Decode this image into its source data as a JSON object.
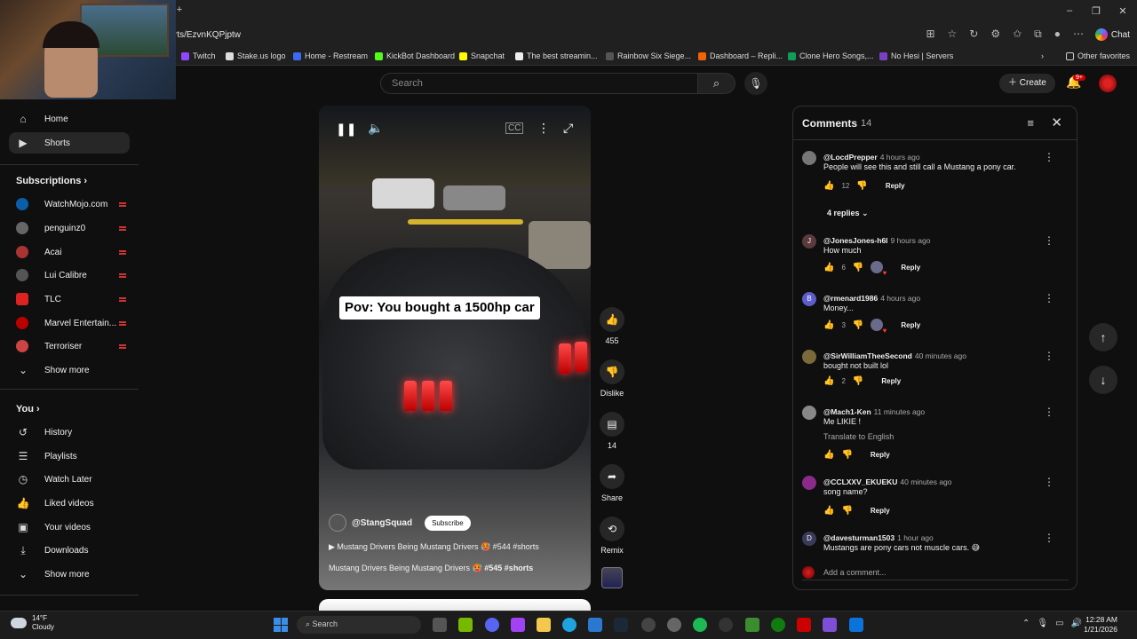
{
  "browser": {
    "url": "rts/EzvnKQPjptw",
    "chat_label": "Chat",
    "bookmarks": [
      "Twitch",
      "Stake.us logo",
      "Home - Restream",
      "KickBot Dashboard",
      "Snapchat",
      "The best streamin...",
      "Rainbow Six Siege...",
      "Dashboard – Repli...",
      "Clone Hero Songs,...",
      "No Hesi | Servers"
    ],
    "other_favorites": "Other favorites"
  },
  "header": {
    "search_placeholder": "Search",
    "create_label": "Create",
    "notification_count": "9+"
  },
  "sidebar": {
    "home": "Home",
    "shorts": "Shorts",
    "subscriptions_title": "Subscriptions",
    "subscriptions": [
      "WatchMojo.com",
      "penguinz0",
      "Acai",
      "Lui Calibre",
      "TLC",
      "Marvel Entertain...",
      "Terroriser"
    ],
    "show_more": "Show more",
    "you_title": "You",
    "you_items": [
      "History",
      "Playlists",
      "Watch Later",
      "Liked videos",
      "Your videos",
      "Downloads"
    ],
    "show_more_2": "Show more"
  },
  "video": {
    "overlay_title": "Pov: You bought a 1500hp car",
    "channel": "@StangSquad",
    "subscribe": "Subscribe",
    "playlist_line": "Mustang Drivers Being Mustang Drivers 🥵 #544 #shorts",
    "title_line_prefix": "Mustang Drivers Being Mustang Drivers 🥵",
    "title_line_tags": "#545 #shorts"
  },
  "actions": {
    "likes": "455",
    "dislike": "Dislike",
    "comments": "14",
    "share": "Share",
    "remix": "Remix"
  },
  "comments_panel": {
    "title": "Comments",
    "count": "14",
    "replies_toggle": "4 replies",
    "add_comment": "Add a comment...",
    "reply_label": "Reply",
    "translate": "Translate to English",
    "items": [
      {
        "author": "@LocdPrepper",
        "time": "4 hours ago",
        "text": "People will see this and still call a Mustang a pony car.",
        "likes": "12"
      },
      {
        "author": "@JonesJones-h6l",
        "time": "9 hours ago",
        "text": "How much",
        "likes": "6"
      },
      {
        "author": "@rmenard1986",
        "time": "4 hours ago",
        "text": "Money...",
        "likes": "3"
      },
      {
        "author": "@SirWilliamTheeSecond",
        "time": "40 minutes ago",
        "text": "bought not built lol",
        "likes": "2"
      },
      {
        "author": "@Mach1-Ken",
        "time": "11 minutes ago",
        "text": "Me LIKIE !",
        "likes": ""
      },
      {
        "author": "@CCLXXV_EKUEKU",
        "time": "40 minutes ago",
        "text": "song name?",
        "likes": ""
      },
      {
        "author": "@davesturman1503",
        "time": "1 hour ago",
        "text": "Mustangs are pony cars not muscle cars. 😅",
        "likes": ""
      }
    ],
    "avatar_letters": [
      "",
      "J",
      "B",
      "",
      "",
      "",
      "D"
    ]
  },
  "taskbar": {
    "temp": "14°F",
    "condition": "Cloudy",
    "search": "Search",
    "time": "12:28 AM",
    "date": "1/21/2026"
  }
}
